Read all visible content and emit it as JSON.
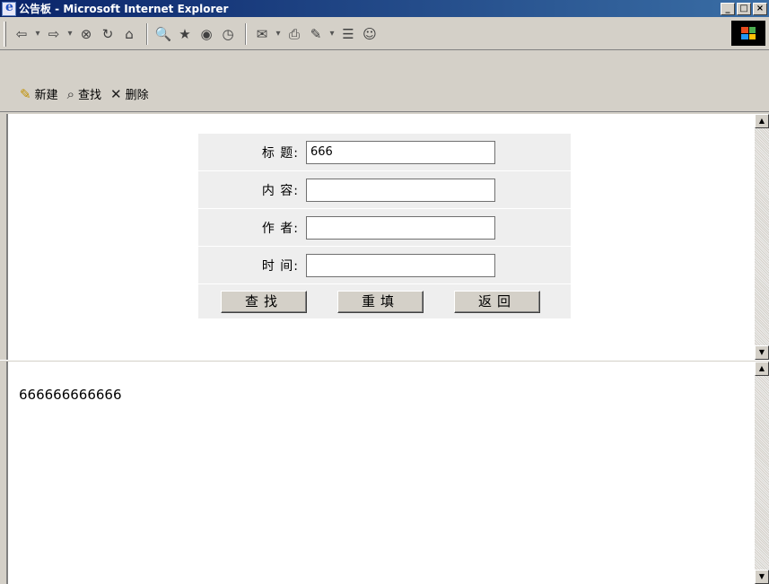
{
  "window": {
    "title": "公告板 - Microsoft Internet Explorer",
    "minimize": "_",
    "maximize": "□",
    "close": "×"
  },
  "browser_toolbar": {
    "back": "⇦",
    "forward": "⇨",
    "dropdown": "▾",
    "stop": "⊗",
    "refresh": "↻",
    "home": "⌂",
    "search": "🔍",
    "favorites": "★",
    "media": "◉",
    "history": "◷",
    "mail": "✉",
    "print": "⎙",
    "edit": "✎",
    "discuss": "☰",
    "messenger": "☺"
  },
  "app_toolbar": {
    "new_label": "新建",
    "find_label": "查找",
    "delete_label": "删除",
    "new_icon": "✎",
    "find_icon": "⌕",
    "delete_icon": "✕"
  },
  "form": {
    "title_label": "标 题:",
    "title_value": "666",
    "content_label": "内 容:",
    "content_value": "",
    "author_label": "作 者:",
    "author_value": "",
    "time_label": "时 间:",
    "time_value": "",
    "find_button": "查找",
    "reset_button": "重填",
    "back_button": "返回"
  },
  "result": {
    "text": "666666666666"
  },
  "scroll": {
    "up": "▲",
    "down": "▼"
  }
}
